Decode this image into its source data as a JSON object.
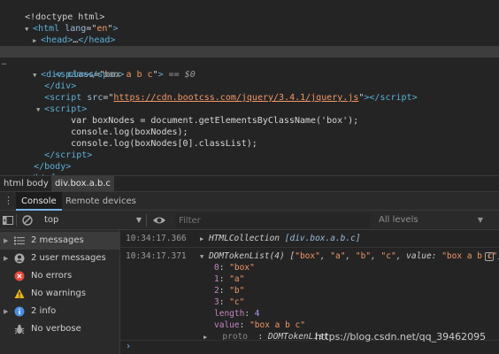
{
  "elements": {
    "doctype": "<!doctype html>",
    "html_open": {
      "tag": "html",
      "attr": "lang",
      "value": "en"
    },
    "head": {
      "tag": "head",
      "ellipsis": "…"
    },
    "body_tag": "body",
    "div": {
      "tag": "div",
      "attr": "class",
      "value": "box a b c",
      "dollar": "== $0"
    },
    "span": "span",
    "script_src": {
      "tag": "script",
      "attr": "src",
      "value": "https://cdn.bootcss.com/jquery/3.4.1/jquery.js"
    },
    "script_tag": "script",
    "code_lines": [
      "var boxNodes = document.getElementsByClassName('box');",
      "console.log(boxNodes);",
      "console.log(boxNodes[0].classList);"
    ],
    "html_close": "html"
  },
  "breadcrumb": [
    "html",
    "body",
    "div.box.a.b.c"
  ],
  "drawer": {
    "menu_icon": "more-vertical-icon",
    "tabs": [
      "Console",
      "Remote devices"
    ],
    "active_tab": "Console"
  },
  "toolbar": {
    "context": "top",
    "filter_placeholder": "Filter",
    "levels": "All levels"
  },
  "sidebar": {
    "items": [
      {
        "label": "2 messages",
        "icon": "list-icon",
        "color": "#a8a8a8"
      },
      {
        "label": "2 user messages",
        "icon": "user-icon",
        "color": "#a8a8a8"
      },
      {
        "label": "No errors",
        "icon": "error-icon",
        "color": "#e5483d"
      },
      {
        "label": "No warnings",
        "icon": "warning-icon",
        "color": "#e7b416"
      },
      {
        "label": "2 info",
        "icon": "info-icon",
        "color": "#4a90e2"
      },
      {
        "label": "No verbose",
        "icon": "bug-icon",
        "color": "#a8a8a8"
      }
    ]
  },
  "messages": [
    {
      "time": "10:34:17.366",
      "type": "HTMLCollection",
      "value": "[div.box.a.b.c]"
    },
    {
      "time": "10:34:17.371",
      "type": "DOMTokenList(4)",
      "summary_parts": [
        "[",
        "\"box\"",
        ", ",
        "\"a\"",
        ", ",
        "\"b\"",
        ", ",
        "\"c\"",
        ", value: ",
        "\"box a b c\"",
        "]"
      ],
      "entries": [
        {
          "key": "0",
          "val": "\"box\""
        },
        {
          "key": "1",
          "val": "\"a\""
        },
        {
          "key": "2",
          "val": "\"b\""
        },
        {
          "key": "3",
          "val": "\"c\""
        }
      ],
      "length_key": "length",
      "length_val": "4",
      "value_key": "value",
      "value_val": "\"box a b c\"",
      "proto_key": "__proto__",
      "proto_val": "DOMTokenList"
    }
  ],
  "watermark": "https://blog.csdn.net/qq_39462095",
  "colors": {
    "tag": "#5db0d7",
    "attr": "#9bbbdc",
    "string": "#f29766",
    "accent": "#7ab4ea"
  }
}
